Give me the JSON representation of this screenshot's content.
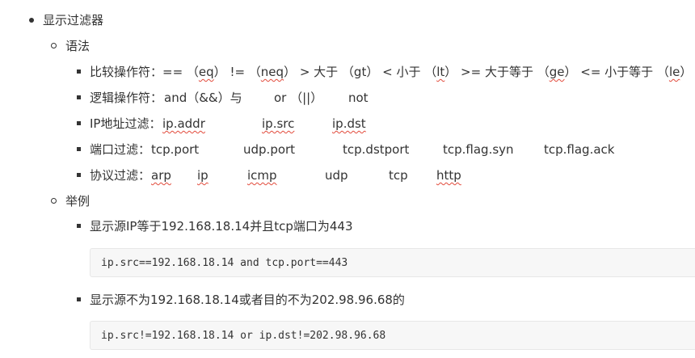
{
  "section_title": "显示过滤器",
  "syntax_title": "语法",
  "syntax": {
    "comparison": {
      "label": "比较操作符：",
      "items": [
        "== （",
        "eq",
        "）  !=  （",
        "neq",
        "）   > 大于 （gt）  < 小于 （",
        "lt",
        "）  >= 大于等于 （",
        "ge",
        "）  <= 小于等于 （",
        "le",
        "）"
      ]
    },
    "logic": {
      "label": "逻辑操作符：",
      "and": "and（&&）与",
      "or": "or （||）",
      "not": "not"
    },
    "ip": {
      "label": "IP地址过滤：",
      "items": [
        "ip.addr",
        "ip.src",
        "ip.dst"
      ]
    },
    "port": {
      "label": "端口过滤：",
      "items": [
        "tcp.port",
        "udp.port",
        "tcp.dstport",
        "tcp.flag.syn",
        "tcp.flag.ack"
      ]
    },
    "protocol": {
      "label": "协议过滤：",
      "items": [
        "arp",
        "ip",
        "icmp",
        "udp",
        "tcp",
        "http"
      ]
    }
  },
  "examples_title": "举例",
  "examples": [
    {
      "desc": "显示源IP等于192.168.18.14并且tcp端口为443",
      "code": "ip.src==192.168.18.14 and tcp.port==443"
    },
    {
      "desc": "显示源不为192.168.18.14或者目的不为202.98.96.68的",
      "code": "ip.src!=192.168.18.14 or ip.dst!=202.98.96.68"
    }
  ]
}
